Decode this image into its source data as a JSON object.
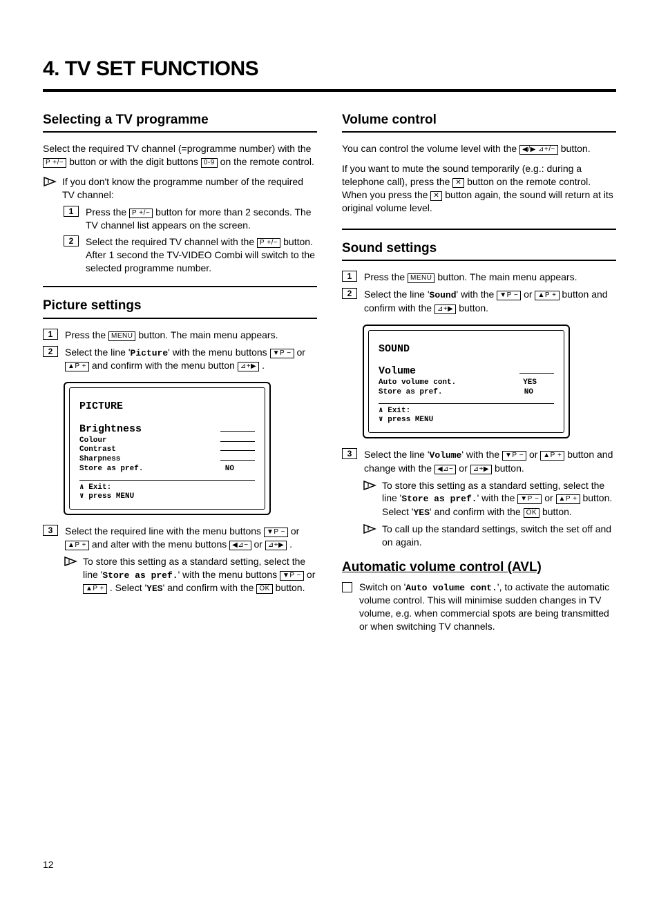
{
  "title": "4.    TV SET FUNCTIONS",
  "page_number": "12",
  "buttons": {
    "p_plus_minus": "P +/−",
    "digits": "0-9",
    "menu": "MENU",
    "down_p_minus": "▼P −",
    "up_p_plus": "▲P +",
    "vol_right": "⊿+▶",
    "vol_left": "◀⊿−",
    "vol_both": "◀/▶ ⊿+/−",
    "mute": "✕",
    "ok": "OK"
  },
  "mono": {
    "picture": "Picture",
    "store_as_pref": "Store as pref.",
    "yes": "YES",
    "sound": "Sound",
    "volume": "Volume",
    "auto_volume_cont": "Auto volume cont."
  },
  "left": {
    "h_select": "Selecting a TV programme",
    "p1a": "Select the required TV channel (=programme number) with the ",
    "p1b": " button or with the digit buttons ",
    "p1c": " on the remote control.",
    "note1": "If you don't know the programme number of the required TV channel:",
    "s1a": "Press the ",
    "s1b": " button for more than 2 seconds. The TV channel list appears on the screen.",
    "s2a": "Select the required TV channel with the ",
    "s2b": " button.",
    "s2c": "After 1 second the TV-VIDEO Combi will switch to the selected programme number.",
    "h_picture": "Picture settings",
    "ps1a": "Press the ",
    "ps1b": " button. The main menu appears.",
    "ps2a": "Select the line '",
    "ps2b": "' with the menu buttons ",
    "ps2c": " or ",
    "ps2d": " and confirm with the menu button ",
    "ps2e": " .",
    "osd_picture": {
      "title": "PICTURE",
      "highlight": "Brightness",
      "rows": [
        "Colour",
        "Contrast",
        "Sharpness"
      ],
      "store": "Store as pref.",
      "store_val": "NO",
      "exit1": "∧ Exit:",
      "exit2": "∨ press MENU"
    },
    "ps3a": "Select the required line with the menu buttons ",
    "ps3b": " or ",
    "ps3c": " and alter with the menu buttons ",
    "ps3d": " or ",
    "ps3e": " .",
    "tip1a": "To store this setting as a standard setting, select the line '",
    "tip1b": "' with the menu buttons ",
    "tip1c": " or ",
    "tip1d": " . Select '",
    "tip1e": "' and confirm with the ",
    "tip1f": " button."
  },
  "right": {
    "h_vol": "Volume control",
    "v1a": "You can control the volume level with the ",
    "v1b": " button.",
    "v2a": "If you want to mute the sound temporarily (e.g.: during a telephone call), press the ",
    "v2b": " button on the remote control. When you press the ",
    "v2c": " button again, the sound will return at its original volume level.",
    "h_sound": "Sound settings",
    "ss1a": "Press the ",
    "ss1b": " button. The main menu appears.",
    "ss2a": "Select the line '",
    "ss2b": "' with the ",
    "ss2c": " or ",
    "ss2d": " button and confirm with the ",
    "ss2e": " button.",
    "osd_sound": {
      "title": "SOUND",
      "highlight": "Volume",
      "row1": "Auto volume cont.",
      "row1_val": "YES",
      "row2": "Store as pref.",
      "row2_val": "NO",
      "exit1": "∧ Exit:",
      "exit2": "∨ press MENU"
    },
    "ss3a": "Select the line '",
    "ss3b": "' with the ",
    "ss3c": " or ",
    "ss3d": " button and change with the ",
    "ss3e": " or ",
    "ss3f": " button.",
    "tip1a": "To store this setting as a standard setting, select the line '",
    "tip1b": "' with the ",
    "tip1c": " or ",
    "tip1d": " button. Select '",
    "tip1e": "' and confirm with the ",
    "tip1f": " button.",
    "tip2": "To call up the standard settings, switch the set off and on again.",
    "h_avl": "Automatic volume control (AVL)",
    "avl1a": "Switch on '",
    "avl1b": "', to activate the automatic volume control. This will minimise sudden changes in TV volume, e.g. when commercial spots are being transmitted or when switching TV channels."
  }
}
